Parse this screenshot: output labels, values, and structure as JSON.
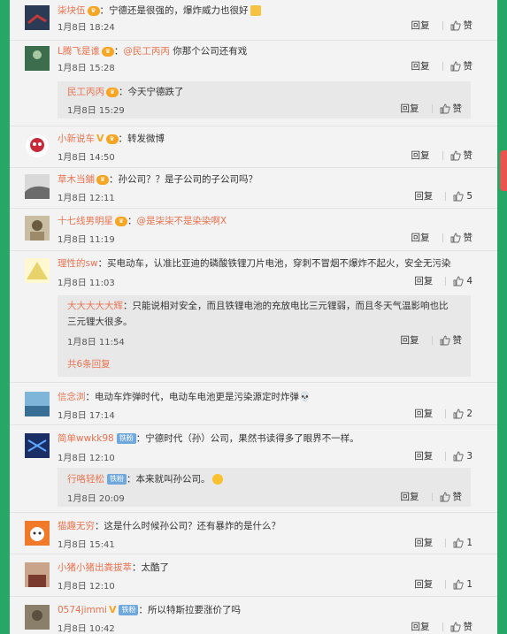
{
  "comments": [
    {
      "name": "柒块伍",
      "badges": [
        "vip"
      ],
      "text_pre": "：宁德还是很强的，爆炸威力也很好",
      "mention": "",
      "text_post": "",
      "emoji": "thumbs-up",
      "time": "1月8日 18:24",
      "reply": "回复",
      "likes": "赞",
      "avatar_color": "#2b3a55"
    },
    {
      "name": "L腾飞是谁",
      "badges": [
        "vip"
      ],
      "text_pre": "：",
      "mention": "@民工丙丙",
      "text_post": " 你那个公司还有戏",
      "time": "1月8日 15:28",
      "reply": "回复",
      "likes": "赞",
      "avatar_color": "#3c6e4e"
    },
    {
      "name": "小新说车",
      "badges": [
        "v",
        "vip"
      ],
      "text_pre": "：转发微博",
      "mention": "",
      "text_post": "",
      "time": "1月8日 14:50",
      "reply": "回复",
      "likes": "赞",
      "avatar_color": "#c92a3a"
    },
    {
      "name": "草木当鋪",
      "badges": [
        "vip"
      ],
      "text_pre": "：孙公司？？是子公司的子公司吗？",
      "mention": "",
      "text_post": "",
      "time": "1月8日 12:11",
      "reply": "回复",
      "likes": "5",
      "avatar_color": "#6b6b6b"
    },
    {
      "name": "十七线男明星",
      "badges": [
        "vip"
      ],
      "text_pre": "：",
      "mention": "@是柒柒不是染染啊X",
      "text_post": "",
      "time": "1月8日 11:19",
      "reply": "回复",
      "likes": "赞",
      "avatar_color": "#9c8a6a"
    },
    {
      "name": "理性的sw",
      "badges": [],
      "text_pre": "：买电动车，认准比亚迪的磷酸铁锂刀片电池，穿刺不冒烟不爆炸不起火，安全无污染",
      "mention": "",
      "text_post": "",
      "time": "1月8日 11:03",
      "reply": "回复",
      "likes": "4",
      "avatar_color": "#e8d36a"
    },
    {
      "name": "信念浏",
      "badges": [],
      "text_pre": "：电动车炸弹时代，电动车电池更是污染源定时炸弹",
      "mention": "",
      "text_post": "",
      "emoji": "skull",
      "time": "1月8日 17:14",
      "reply": "回复",
      "likes": "2",
      "avatar_color": "#4a8fbf"
    },
    {
      "name": "简单wwkk98",
      "badges": [
        "fan"
      ],
      "text_pre": "：宁德时代（孙）公司，果然书读得多了眼界不一样。",
      "mention": "",
      "text_post": "",
      "time": "1月8日 12:10",
      "reply": "回复",
      "likes": "3",
      "avatar_color": "#1b2f66"
    },
    {
      "name": "猫趣无穷",
      "badges": [],
      "text_pre": "：这是什么时候孙公司？还有暴炸的是什么？",
      "mention": "",
      "text_post": "",
      "time": "1月8日 15:41",
      "reply": "回复",
      "likes": "1",
      "avatar_color": "#f07a2a"
    },
    {
      "name": "小猪小猪出粪拔萃",
      "badges": [],
      "text_pre": "：太酷了",
      "mention": "",
      "text_post": "",
      "time": "1月8日 12:10",
      "reply": "回复",
      "likes": "1",
      "avatar_color": "#7a3b2e"
    },
    {
      "name": "0574jimmi",
      "badges": [
        "v",
        "fan"
      ],
      "text_pre": "：所以特斯拉要涨价了吗",
      "mention": "",
      "text_post": "",
      "time": "1月8日 10:42",
      "reply": "回复",
      "likes": "赞",
      "avatar_color": "#5a5040"
    }
  ],
  "subreplies": [
    {
      "name": "民工丙丙",
      "badges": [
        "vip"
      ],
      "text": "：今天宁德跌了",
      "time": "1月8日 15:29",
      "reply": "回复",
      "likes": "赞"
    },
    {
      "name": "大大大大大辉",
      "badges": [],
      "text": "：只能说相对安全，而且铁锂电池的充放电比三元锂弱，而且冬天气温影响也比",
      "text2": "三元锂大很多。",
      "time": "1月8日 11:54",
      "reply": "回复",
      "likes": "赞",
      "more": "共6条回复"
    },
    {
      "name": "行咯轻松",
      "badges": [
        "fan"
      ],
      "text": "：本来就叫孙公司。",
      "emoji": "shock",
      "time": "1月8日 20:09",
      "reply": "回复",
      "likes": "赞"
    }
  ],
  "labels": {
    "fan_badge": "铁粉",
    "v_badge": "V"
  },
  "colors": {
    "accent": "#eb7350",
    "background": "#27a765",
    "panel": "#f3f3f3"
  }
}
